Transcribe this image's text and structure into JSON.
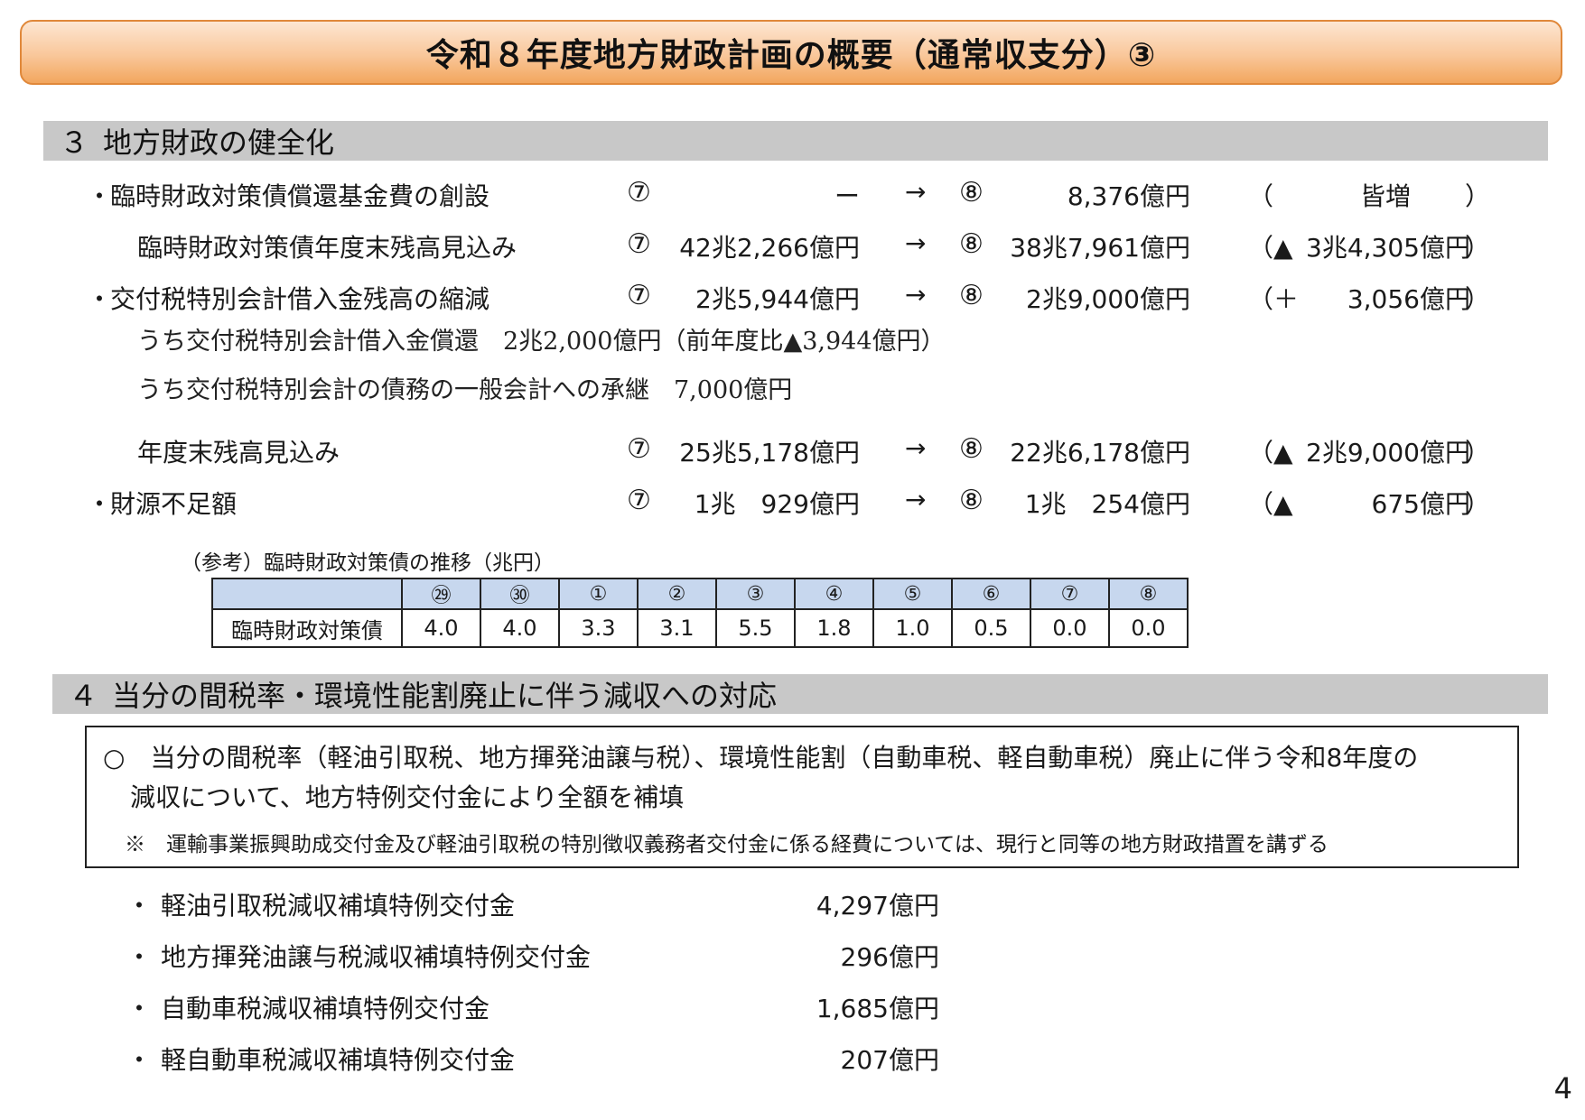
{
  "title": "令和８年度地方財政計画の概要（通常収支分）③",
  "section3": {
    "num": "３",
    "label": "地方財政の健全化",
    "rows": [
      {
        "bullet": "・",
        "label": "臨時財政対策債償還基金費の創設",
        "c7": "⑦",
        "from": "ー",
        "arrow": "→",
        "c8": "⑧",
        "to": "8,376億円",
        "open": "（",
        "diff": "皆増",
        "close": "）"
      },
      {
        "bullet": "",
        "label": "臨時財政対策債年度末残高見込み",
        "c7": "⑦",
        "from": "42兆2,266億円",
        "arrow": "→",
        "c8": "⑧",
        "to": "38兆7,961億円",
        "open": "（▲",
        "diff": "3兆4,305億円",
        "close": "）"
      },
      {
        "bullet": "・",
        "label": "交付税特別会計借入金残高の縮減",
        "c7": "⑦",
        "from": "2兆5,944億円",
        "arrow": "→",
        "c8": "⑧",
        "to": "2兆9,000億円",
        "open": "（＋",
        "diff": "3,056億円",
        "close": "）"
      },
      {
        "bullet": "",
        "label": "年度末残高見込み",
        "c7": "⑦",
        "from": "25兆5,178億円",
        "arrow": "→",
        "c8": "⑧",
        "to": "22兆6,178億円",
        "open": "（▲",
        "diff": "2兆9,000億円",
        "close": "）"
      },
      {
        "bullet": "・",
        "label": "財源不足額",
        "c7": "⑦",
        "from": "1兆　929億円",
        "arrow": "→",
        "c8": "⑧",
        "to": "1兆　254億円",
        "open": "（▲",
        "diff": "675億円",
        "close": "）"
      }
    ],
    "sub_line1": "うち交付税特別会計借入金償還　2兆2,000億円（前年度比▲3,944億円）",
    "sub_line2": "うち交付税特別会計の債務の一般会計への承継　7,000億円"
  },
  "reference": {
    "caption": "（参考）臨時財政対策債の推移（兆円）",
    "row_label": "臨時財政対策債",
    "headers": [
      "㉙",
      "㉚",
      "①",
      "②",
      "③",
      "④",
      "⑤",
      "⑥",
      "⑦",
      "⑧"
    ],
    "values": [
      "4.0",
      "4.0",
      "3.3",
      "3.1",
      "5.5",
      "1.8",
      "1.0",
      "0.5",
      "0.0",
      "0.0"
    ]
  },
  "section4": {
    "num": "４",
    "label": "当分の間税率・環境性能割廃止に伴う減収への対応",
    "box_line1": "○　当分の間税率（軽油引取税、地方揮発油譲与税）、環境性能割（自動車税、軽自動車税）廃止に伴う令和8年度の",
    "box_line2": "減収について、地方特例交付金により全額を補填",
    "box_note": "※　運輸事業振興助成交付金及び軽油引取税の特別徴収義務者交付金に係る経費については、現行と同等の地方財政措置を講ずる",
    "grants": [
      {
        "dot": "・",
        "label": "軽油引取税減収補填特例交付金",
        "amount": "4,297億円"
      },
      {
        "dot": "・",
        "label": "地方揮発油譲与税減収補填特例交付金",
        "amount": "296億円"
      },
      {
        "dot": "・",
        "label": "自動車税減収補填特例交付金",
        "amount": "1,685億円"
      },
      {
        "dot": "・",
        "label": "軽自動車税減収補填特例交付金",
        "amount": "207億円"
      }
    ]
  },
  "page_number": "4"
}
